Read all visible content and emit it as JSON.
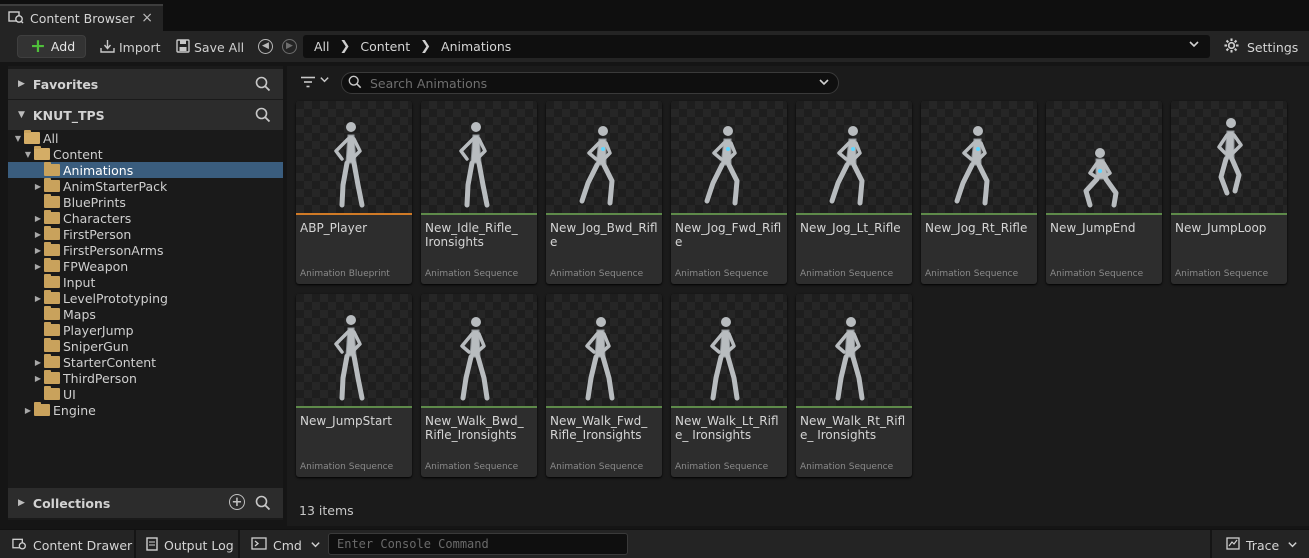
{
  "tab": {
    "title": "Content Browser",
    "close": "×"
  },
  "toolbar": {
    "add_label": "Add",
    "import_label": "Import",
    "saveall_label": "Save All",
    "settings_label": "Settings",
    "breadcrumb": [
      "All",
      "Content",
      "Animations"
    ]
  },
  "favorites": {
    "label": "Favorites"
  },
  "project": {
    "label": "KNUT_TPS"
  },
  "tree": [
    {
      "label": "All",
      "level": 0,
      "expanded": true,
      "hasChildren": true,
      "selected": false
    },
    {
      "label": "Content",
      "level": 1,
      "expanded": true,
      "hasChildren": true,
      "selected": false
    },
    {
      "label": "Animations",
      "level": 2,
      "expanded": false,
      "hasChildren": false,
      "selected": true
    },
    {
      "label": "AnimStarterPack",
      "level": 2,
      "expanded": false,
      "hasChildren": true,
      "selected": false
    },
    {
      "label": "BluePrints",
      "level": 2,
      "expanded": false,
      "hasChildren": false,
      "selected": false
    },
    {
      "label": "Characters",
      "level": 2,
      "expanded": false,
      "hasChildren": true,
      "selected": false
    },
    {
      "label": "FirstPerson",
      "level": 2,
      "expanded": false,
      "hasChildren": true,
      "selected": false
    },
    {
      "label": "FirstPersonArms",
      "level": 2,
      "expanded": false,
      "hasChildren": true,
      "selected": false
    },
    {
      "label": "FPWeapon",
      "level": 2,
      "expanded": false,
      "hasChildren": true,
      "selected": false
    },
    {
      "label": "Input",
      "level": 2,
      "expanded": false,
      "hasChildren": false,
      "selected": false
    },
    {
      "label": "LevelPrototyping",
      "level": 2,
      "expanded": false,
      "hasChildren": true,
      "selected": false
    },
    {
      "label": "Maps",
      "level": 2,
      "expanded": false,
      "hasChildren": false,
      "selected": false
    },
    {
      "label": "PlayerJump",
      "level": 2,
      "expanded": false,
      "hasChildren": false,
      "selected": false
    },
    {
      "label": "SniperGun",
      "level": 2,
      "expanded": false,
      "hasChildren": false,
      "selected": false
    },
    {
      "label": "StarterContent",
      "level": 2,
      "expanded": false,
      "hasChildren": true,
      "selected": false
    },
    {
      "label": "ThirdPerson",
      "level": 2,
      "expanded": false,
      "hasChildren": true,
      "selected": false
    },
    {
      "label": "UI",
      "level": 2,
      "expanded": false,
      "hasChildren": false,
      "selected": false
    },
    {
      "label": "Engine",
      "level": 1,
      "expanded": false,
      "hasChildren": true,
      "selected": false
    }
  ],
  "collections": {
    "label": "Collections"
  },
  "search": {
    "placeholder": "Search Animations"
  },
  "assets": [
    {
      "name": "ABP_Player",
      "type": "Animation Blueprint",
      "kind": "blueprint",
      "pose": "stand"
    },
    {
      "name": "New_Idle_Rifle_ Ironsights",
      "type": "Animation Sequence",
      "kind": "sequence",
      "pose": "stand"
    },
    {
      "name": "New_Jog_Bwd_Rifle",
      "type": "Animation Sequence",
      "kind": "sequence",
      "pose": "jog"
    },
    {
      "name": "New_Jog_Fwd_Rifle",
      "type": "Animation Sequence",
      "kind": "sequence",
      "pose": "jog"
    },
    {
      "name": "New_Jog_Lt_Rifle",
      "type": "Animation Sequence",
      "kind": "sequence",
      "pose": "jog"
    },
    {
      "name": "New_Jog_Rt_Rifle",
      "type": "Animation Sequence",
      "kind": "sequence",
      "pose": "jog"
    },
    {
      "name": "New_JumpEnd",
      "type": "Animation Sequence",
      "kind": "sequence",
      "pose": "crouch"
    },
    {
      "name": "New_JumpLoop",
      "type": "Animation Sequence",
      "kind": "sequence",
      "pose": "jump"
    },
    {
      "name": "New_JumpStart",
      "type": "Animation Sequence",
      "kind": "sequence",
      "pose": "stand"
    },
    {
      "name": "New_Walk_Bwd_ Rifle_Ironsights",
      "type": "Animation Sequence",
      "kind": "sequence",
      "pose": "walk"
    },
    {
      "name": "New_Walk_Fwd_ Rifle_Ironsights",
      "type": "Animation Sequence",
      "kind": "sequence",
      "pose": "walk"
    },
    {
      "name": "New_Walk_Lt_Rifle_ Ironsights",
      "type": "Animation Sequence",
      "kind": "sequence",
      "pose": "walk"
    },
    {
      "name": "New_Walk_Rt_Rifle_ Ironsights",
      "type": "Animation Sequence",
      "kind": "sequence",
      "pose": "walk"
    }
  ],
  "item_count": "13 items",
  "statusbar": {
    "drawer_label": "Content Drawer",
    "outputlog_label": "Output Log",
    "cmd_label": "Cmd",
    "console_placeholder": "Enter Console Command",
    "trace_label": "Trace"
  },
  "colors": {
    "selection": "#3a5d7e",
    "folder": "#c9a25c",
    "sequence_line": "#5e8a4a",
    "blueprint_line": "#d07a26",
    "add_plus": "#4fbf3a"
  }
}
